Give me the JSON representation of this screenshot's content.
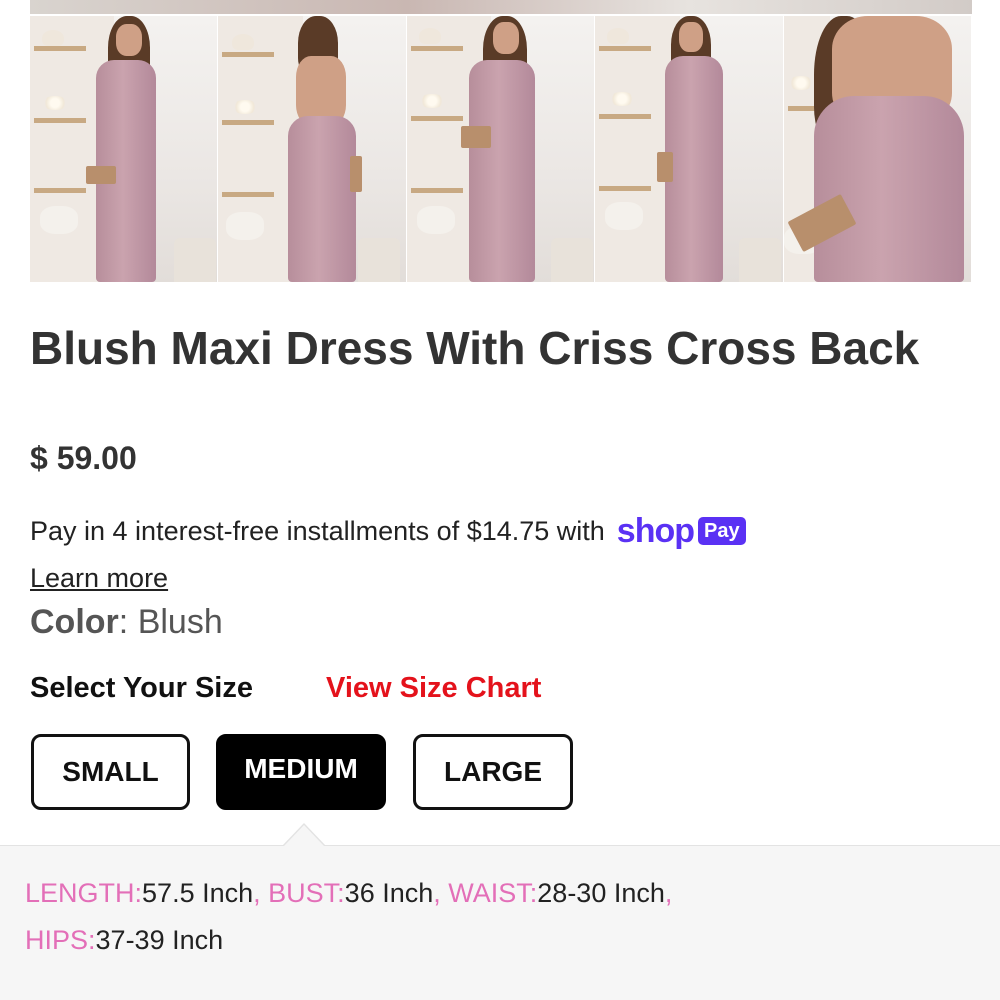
{
  "gallery": {
    "photos": [
      "front",
      "back",
      "front-wrap",
      "side",
      "detail"
    ]
  },
  "product": {
    "title": "Blush Maxi Dress With Criss Cross Back",
    "price": "$ 59.00"
  },
  "payment": {
    "installments_text": "Pay in 4 interest-free installments of $14.75 with",
    "shop_logo": "shop",
    "shop_badge": "Pay",
    "learn_more": "Learn more",
    "brand_color": "#5a31f4"
  },
  "color": {
    "label": "Color",
    "separator": ":",
    "value": "Blush"
  },
  "size": {
    "heading": "Select Your Size",
    "chart_link": "View Size Chart",
    "options": [
      "SMALL",
      "MEDIUM",
      "LARGE"
    ],
    "selected": "MEDIUM"
  },
  "measurements": {
    "length_label": "LENGTH:",
    "length_value": "57.5 Inch",
    "bust_label": "BUST:",
    "bust_value": "36 Inch",
    "waist_label": "WAIST:",
    "waist_value": "28-30 Inch",
    "hips_label": "HIPS:",
    "hips_value": "37-39 Inch",
    "separator": ", ",
    "label_color": "#e36fb8"
  },
  "colors": {
    "accent_red": "#e4121b",
    "text_dark": "#333333"
  }
}
